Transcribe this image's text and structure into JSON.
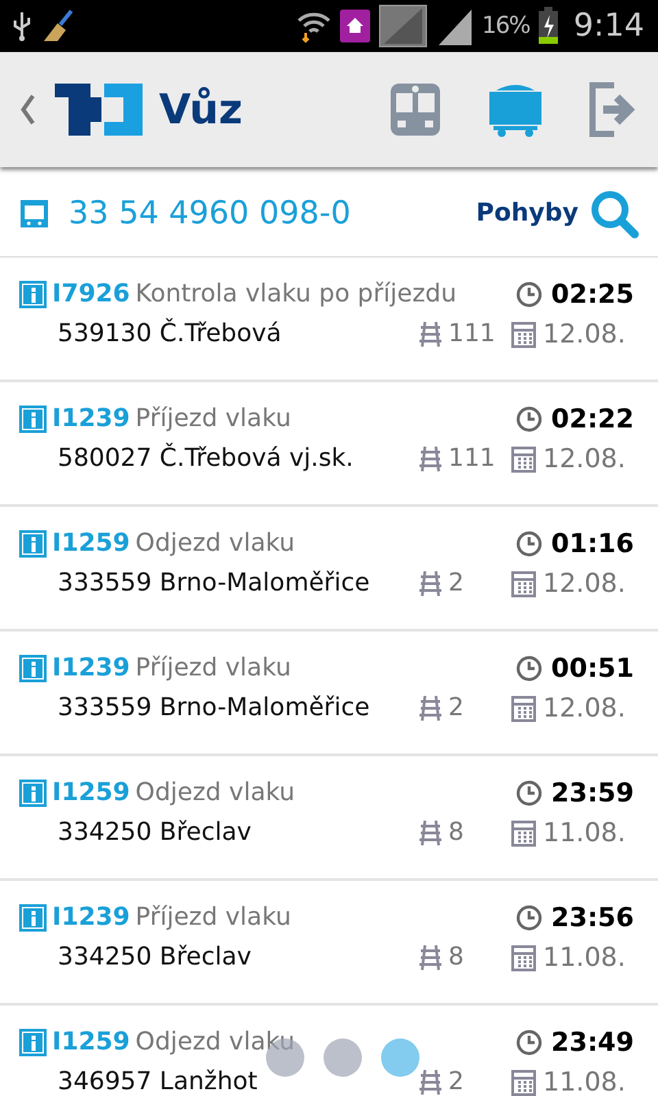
{
  "status_bar": {
    "battery": "16%",
    "time": "9:14"
  },
  "header": {
    "title": "Vůz"
  },
  "toolbar": [
    {
      "kind": "train",
      "selected": false
    },
    {
      "kind": "wagon",
      "selected": true
    },
    {
      "kind": "exit",
      "selected": false
    }
  ],
  "wagon": {
    "number": "33 54 4960 098-0",
    "action": "Pohyby"
  },
  "movements": [
    {
      "code": "I7926",
      "description": "Kontrola vlaku po příjezdu",
      "time": "02:25",
      "station": "539130 Č.Třebová",
      "track": "111",
      "date": "12.08."
    },
    {
      "code": "I1239",
      "description": "Příjezd vlaku",
      "time": "02:22",
      "station": "580027 Č.Třebová vj.sk.",
      "track": "111",
      "date": "12.08."
    },
    {
      "code": "I1259",
      "description": "Odjezd vlaku",
      "time": "01:16",
      "station": "333559 Brno-Maloměřice",
      "track": "2",
      "date": "12.08."
    },
    {
      "code": "I1239",
      "description": "Příjezd vlaku",
      "time": "00:51",
      "station": "333559 Brno-Maloměřice",
      "track": "2",
      "date": "12.08."
    },
    {
      "code": "I1259",
      "description": "Odjezd vlaku",
      "time": "23:59",
      "station": "334250 Břeclav",
      "track": "8",
      "date": "11.08."
    },
    {
      "code": "I1239",
      "description": "Příjezd vlaku",
      "time": "23:56",
      "station": "334250 Břeclav",
      "track": "8",
      "date": "11.08."
    },
    {
      "code": "I1259",
      "description": "Odjezd vlaku",
      "time": "23:49",
      "station": "346957 Lanžhot",
      "track": "2",
      "date": "11.08."
    }
  ],
  "pager": [
    {
      "selected": false
    },
    {
      "selected": false
    },
    {
      "selected": true
    }
  ]
}
